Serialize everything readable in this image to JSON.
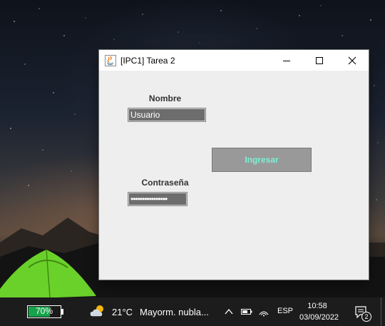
{
  "window": {
    "title": "[IPC1] Tarea 2",
    "form": {
      "nombre_label": "Nombre",
      "usuario_value": "Usuario",
      "ingresar_label": "Ingresar",
      "contrasena_label": "Contraseña",
      "password_mask": "••••••••••••••••"
    }
  },
  "taskbar": {
    "battery_text": "70%",
    "battery_level": 0.7,
    "temperature": "21°C",
    "forecast": "Mayorm. nubla...",
    "language": "ESP",
    "time": "10:58",
    "date": "03/09/2022",
    "notification_count": "2"
  },
  "colors": {
    "ingresar_text": "#7cf2d6",
    "field_bg": "#6d6d6d",
    "battery_fill": "#16a34a"
  }
}
